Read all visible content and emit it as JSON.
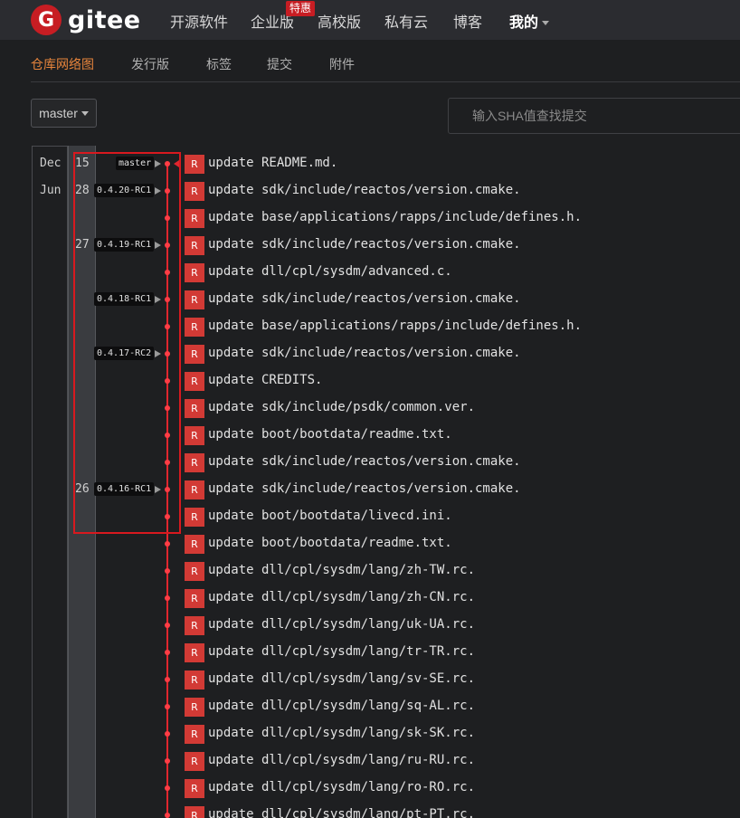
{
  "nav": {
    "logo_letter": "G",
    "logo_text": "gitee",
    "items": [
      "开源软件",
      "企业版",
      "高校版",
      "私有云",
      "博客"
    ],
    "badge": "特惠",
    "user_menu": "我的"
  },
  "subnav": {
    "tabs": [
      "仓库网络图",
      "发行版",
      "标签",
      "提交",
      "附件"
    ],
    "active_index": 0
  },
  "toolbar": {
    "branch": "master",
    "sha_placeholder": "输入SHA值查找提交"
  },
  "graph": {
    "months": [
      {
        "label": "Dec",
        "row": 0
      },
      {
        "label": "Jun",
        "row": 1
      }
    ],
    "days": [
      {
        "label": "15",
        "row": 0
      },
      {
        "label": "28",
        "row": 1
      },
      {
        "label": "27",
        "row": 3
      },
      {
        "label": "26",
        "row": 12
      }
    ],
    "tags": [
      {
        "label": "master",
        "row": 0
      },
      {
        "label": "0.4.20-RC1",
        "row": 1
      },
      {
        "label": "0.4.19-RC1",
        "row": 3
      },
      {
        "label": "0.4.18-RC1",
        "row": 5
      },
      {
        "label": "0.4.17-RC2",
        "row": 7
      },
      {
        "label": "0.4.16-RC1",
        "row": 12
      }
    ],
    "avatar_letter": "R",
    "commits": [
      "update README.md.",
      "update sdk/include/reactos/version.cmake.",
      "update base/applications/rapps/include/defines.h.",
      "update sdk/include/reactos/version.cmake.",
      "update dll/cpl/sysdm/advanced.c.",
      "update sdk/include/reactos/version.cmake.",
      "update base/applications/rapps/include/defines.h.",
      "update sdk/include/reactos/version.cmake.",
      "update CREDITS.",
      "update sdk/include/psdk/common.ver.",
      "update boot/bootdata/readme.txt.",
      "update sdk/include/reactos/version.cmake.",
      "update sdk/include/reactos/version.cmake.",
      "update boot/bootdata/livecd.ini.",
      "update boot/bootdata/readme.txt.",
      "update dll/cpl/sysdm/lang/zh-TW.rc.",
      "update dll/cpl/sysdm/lang/zh-CN.rc.",
      "update dll/cpl/sysdm/lang/uk-UA.rc.",
      "update dll/cpl/sysdm/lang/tr-TR.rc.",
      "update dll/cpl/sysdm/lang/sv-SE.rc.",
      "update dll/cpl/sysdm/lang/sq-AL.rc.",
      "update dll/cpl/sysdm/lang/sk-SK.rc.",
      "update dll/cpl/sysdm/lang/ru-RU.rc.",
      "update dll/cpl/sysdm/lang/ro-RO.rc.",
      "update dll/cpl/sysdm/lang/pt-PT.rc."
    ]
  }
}
